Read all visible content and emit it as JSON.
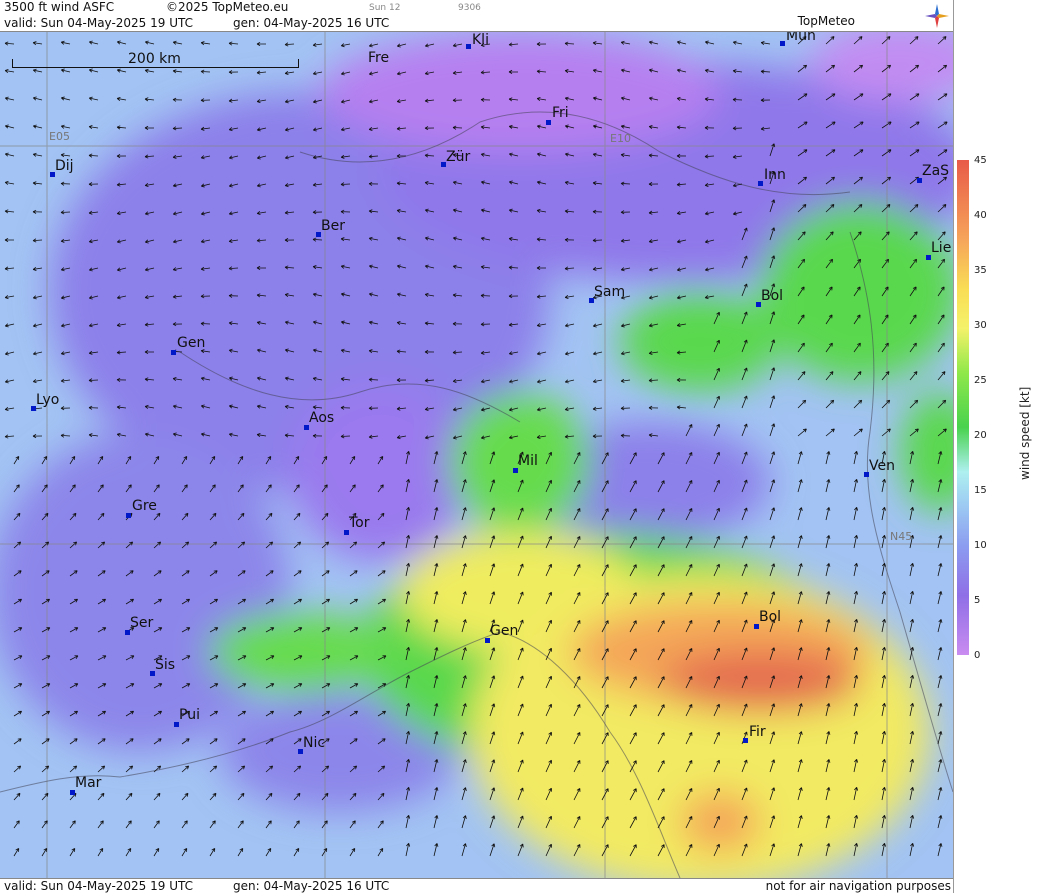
{
  "header": {
    "product": "3500 ft wind ASFC",
    "copyright": "©2025 TopMeteo.eu",
    "mini_time": "Sun 12",
    "mini_code": "9306",
    "valid": "valid:  Sun  04-May-2025  19 UTC",
    "gen": "gen: 04-May-2025 16 UTC",
    "logo": "TopMeteo"
  },
  "footer": {
    "valid": "valid:  Sun  04-May-2025  19 UTC",
    "gen": "gen: 04-May-2025 16 UTC",
    "note": "not for air navigation purposes"
  },
  "scale_bar": {
    "label": "200 km"
  },
  "grid_labels": {
    "e05": "E05",
    "e10": "E10",
    "n45": "N45"
  },
  "legend": {
    "title": "wind speed [kt]",
    "ticks": [
      "45",
      "40",
      "35",
      "30",
      "25",
      "20",
      "15",
      "10",
      "5",
      "0"
    ]
  },
  "cities": [
    {
      "id": "kli",
      "name": "Kli"
    },
    {
      "id": "mun",
      "name": "Mün"
    },
    {
      "id": "fre",
      "name": "Fre"
    },
    {
      "id": "fri",
      "name": "Fri"
    },
    {
      "id": "dij",
      "name": "Dij"
    },
    {
      "id": "zur",
      "name": "Zür"
    },
    {
      "id": "inn",
      "name": "Inn"
    },
    {
      "id": "zas",
      "name": "ZaS"
    },
    {
      "id": "ber",
      "name": "Ber"
    },
    {
      "id": "lie",
      "name": "Lie"
    },
    {
      "id": "sam",
      "name": "Sam"
    },
    {
      "id": "bol1",
      "name": "Bol"
    },
    {
      "id": "gen1",
      "name": "Gen"
    },
    {
      "id": "lyo",
      "name": "Lyo"
    },
    {
      "id": "aos",
      "name": "Aos"
    },
    {
      "id": "mil",
      "name": "Mil"
    },
    {
      "id": "ven",
      "name": "Ven"
    },
    {
      "id": "gre",
      "name": "Gre"
    },
    {
      "id": "tor",
      "name": "Tor"
    },
    {
      "id": "ser",
      "name": "Ser"
    },
    {
      "id": "gen2",
      "name": "Gen"
    },
    {
      "id": "bol2",
      "name": "Bol"
    },
    {
      "id": "sis",
      "name": "Sis"
    },
    {
      "id": "pui",
      "name": "Pui"
    },
    {
      "id": "nic",
      "name": "Nic"
    },
    {
      "id": "fir",
      "name": "Fir"
    },
    {
      "id": "mar",
      "name": "Mar"
    }
  ]
}
